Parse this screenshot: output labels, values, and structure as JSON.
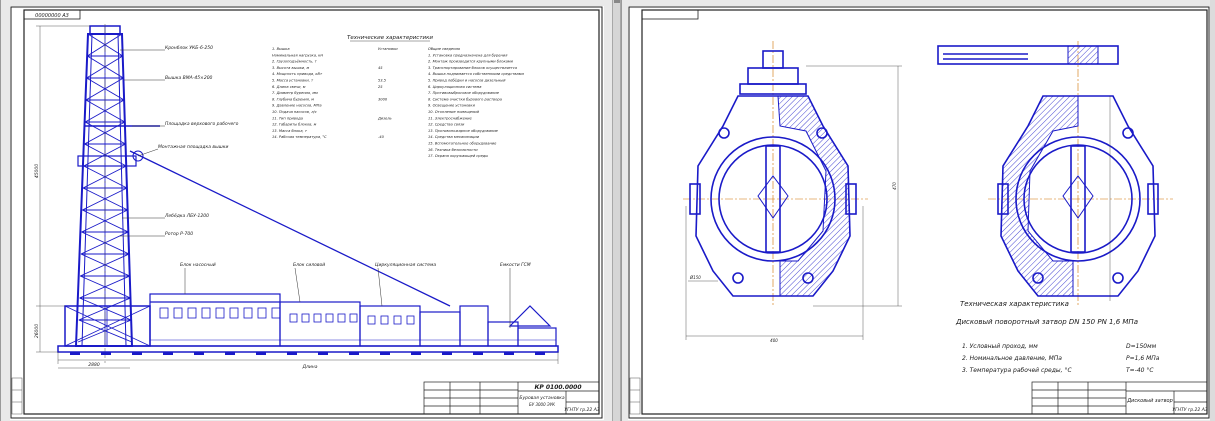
{
  "left_sheet": {
    "top_stamp": "00000000 А3",
    "main_title": "Технические характеристики",
    "tech_left": [
      "1. Вышка",
      "   Номинальная нагрузка, кН",
      "2. Грузоподъёмность, т",
      "3. Высота вышки, м",
      "4. Мощность привода, кВт",
      "5. Масса установки, т",
      "6. Длина свечи, м",
      "7. Диаметр бурения, мм",
      "8. Глубина бурения, м",
      "9. Давление насосов, МПа",
      "10. Подача насосов, л/с",
      "11. Тип привода",
      "12. Габариты блоков, м",
      "13. Масса блока, т",
      "14. Рабочая температура, °С"
    ],
    "tech_mid": [
      "Установки",
      "",
      "",
      "45",
      "",
      "53,5",
      "25",
      "",
      "3000",
      "",
      "",
      "Дизель",
      "",
      "",
      "-40"
    ],
    "tech_right": [
      "Общие сведения",
      "1. Установка предназначена для бурения",
      "2. Монтаж производится крупными блоками",
      "3. Транспортирование блоков осуществляется",
      "4. Вышка поднимается собственными средствами",
      "5. Привод лебёдки и насосов дизельный",
      "6. Циркуляционная система",
      "7. Противовыбросовое оборудование",
      "8. Система очистки бурового раствора",
      "9. Освещение установки",
      "10. Отопление помещений",
      "11. Электроснабжение",
      "12. Средства связи",
      "13. Противопожарное оборудование",
      "14. Средства механизации",
      "15. Вспомогательное оборудование",
      "16. Техника безопасности",
      "17. Охрана окружающей среды"
    ],
    "callouts": [
      "Кронблок УКБ-6-250",
      "Вышка ВМА-45×200",
      "Площадка верхового рабочего",
      "Монтажная площадка вышки",
      "Лебёдка ЛБУ-1200",
      "Ротор Р-700",
      "Блок насосный",
      "Блок силовой",
      "Циркуляционная система",
      "Емкости ГСМ"
    ],
    "dims": [
      "45000",
      "26000",
      "2880",
      "Длина"
    ],
    "stamp_code": "КР 0100.0000",
    "stamp_name": "Буровая установка",
    "stamp_sub": "БУ 3000 ЭУК",
    "stamp_org": "УГНТУ гр.22 А3"
  },
  "right_sheet": {
    "tech_title": "Техническая характеристика",
    "product_line": "Дисковый поворотный затвор DN 150 PN 1,6 МПа",
    "spec_rows": [
      {
        "label": "1. Условный проход, мм",
        "value": "D=150мм"
      },
      {
        "label": "2. Номинальное давление, МПа",
        "value": "P=1,6 МПа"
      },
      {
        "label": "3. Температура рабочей среды, °С",
        "value": "T=-40 °С"
      }
    ],
    "dims": [
      "400",
      "470",
      "Ø150"
    ],
    "stamp_name": "Дисковый затвор",
    "stamp_org": "УГНТУ гр.22 А3"
  }
}
